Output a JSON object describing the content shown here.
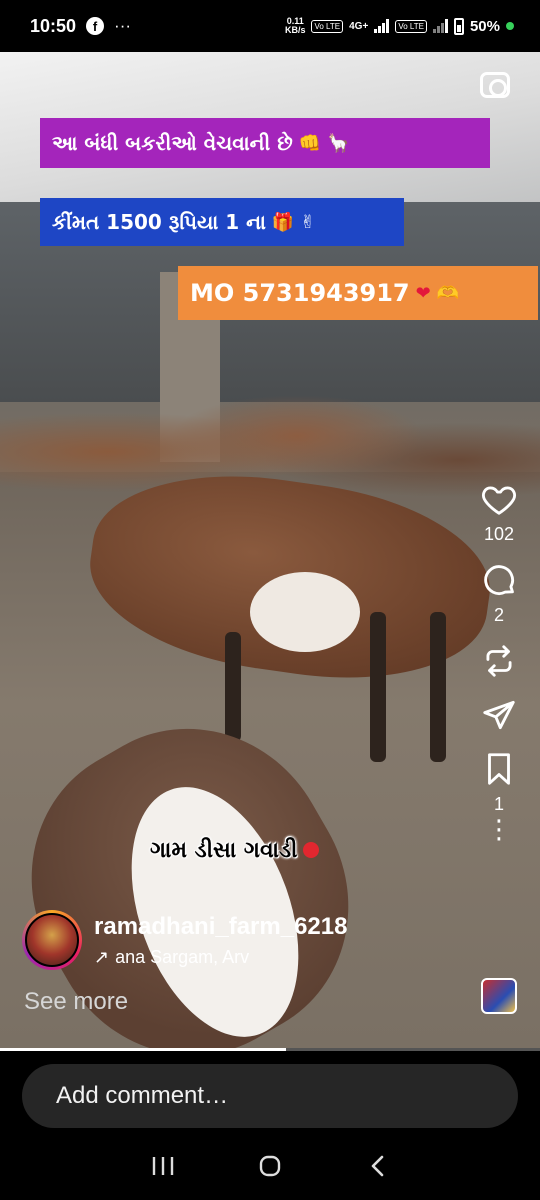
{
  "status_bar": {
    "time": "10:50",
    "app_icon": "facebook-icon",
    "more_indicator": "···",
    "net_speed_top": "0.11",
    "net_speed_bottom": "KB/s",
    "sim1_label": "Vo LTE",
    "network_type": "4G+",
    "sim2_label": "Vo LTE",
    "battery_percent": "50%"
  },
  "video": {
    "camera_button_icon": "camera-icon",
    "overlay_texts": [
      "આ બંધી બકરીઓ વેચવાની છે",
      "કીંમત 1500 રૂપિયા 1 ના",
      "MO 5731943917"
    ],
    "overlay_emojis": [
      "👊",
      "🦙",
      "🎁",
      "✌",
      "❤",
      "🫶"
    ],
    "location_text": "ગામ ડીસા ગવાડી",
    "progress": 0.53
  },
  "side_actions": {
    "like_count": "102",
    "comment_count": "2",
    "remix_count": "",
    "save_count": "1"
  },
  "author": {
    "username": "ramadhani_farm_6218",
    "audio_arrow": "↗",
    "audio_text": "ana Sargam, Arv",
    "see_more": "See more"
  },
  "comment": {
    "placeholder": "Add comment…"
  },
  "colors": {
    "banner_purple": "#a425bb",
    "banner_blue": "#1e46c5",
    "banner_orange": "#f08d3d"
  }
}
